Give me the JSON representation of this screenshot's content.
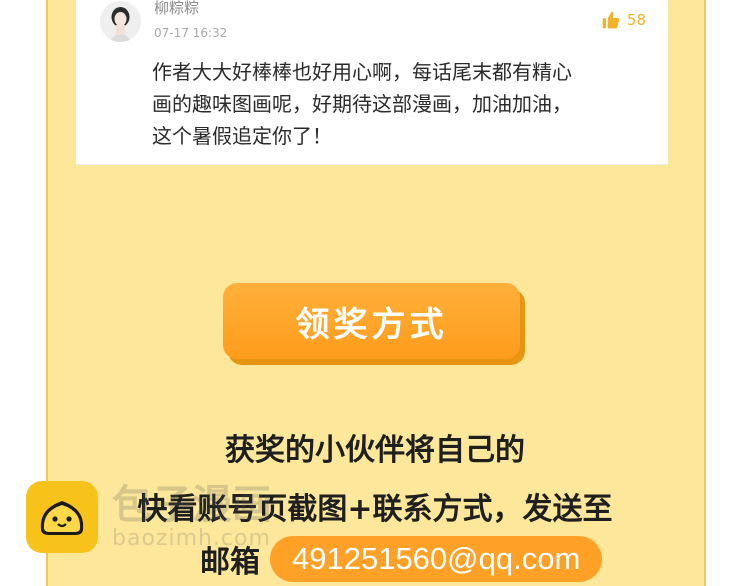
{
  "comment": {
    "username": "柳粽粽",
    "timestamp": "07-17 16:32",
    "likes": "58",
    "lines": [
      "作者大大好棒棒也好用心啊，每话尾末都有精心",
      "画的趣味图画呢，好期待这部漫画，加油加油，",
      "这个暑假追定你了！"
    ]
  },
  "section": {
    "button_label": "领奖方式",
    "line1": "获奖的小伙伴将自己的",
    "line2": "快看账号页截图+联系方式，发送至",
    "email_label": "邮箱",
    "email": "491251560@qq.com"
  },
  "watermark": {
    "title": "包子漫画",
    "subtitle": "baozimh.com"
  },
  "colors": {
    "panel_bg": "#fde79a",
    "button_orange": "#ffa126",
    "like_color": "#f2b22a"
  }
}
